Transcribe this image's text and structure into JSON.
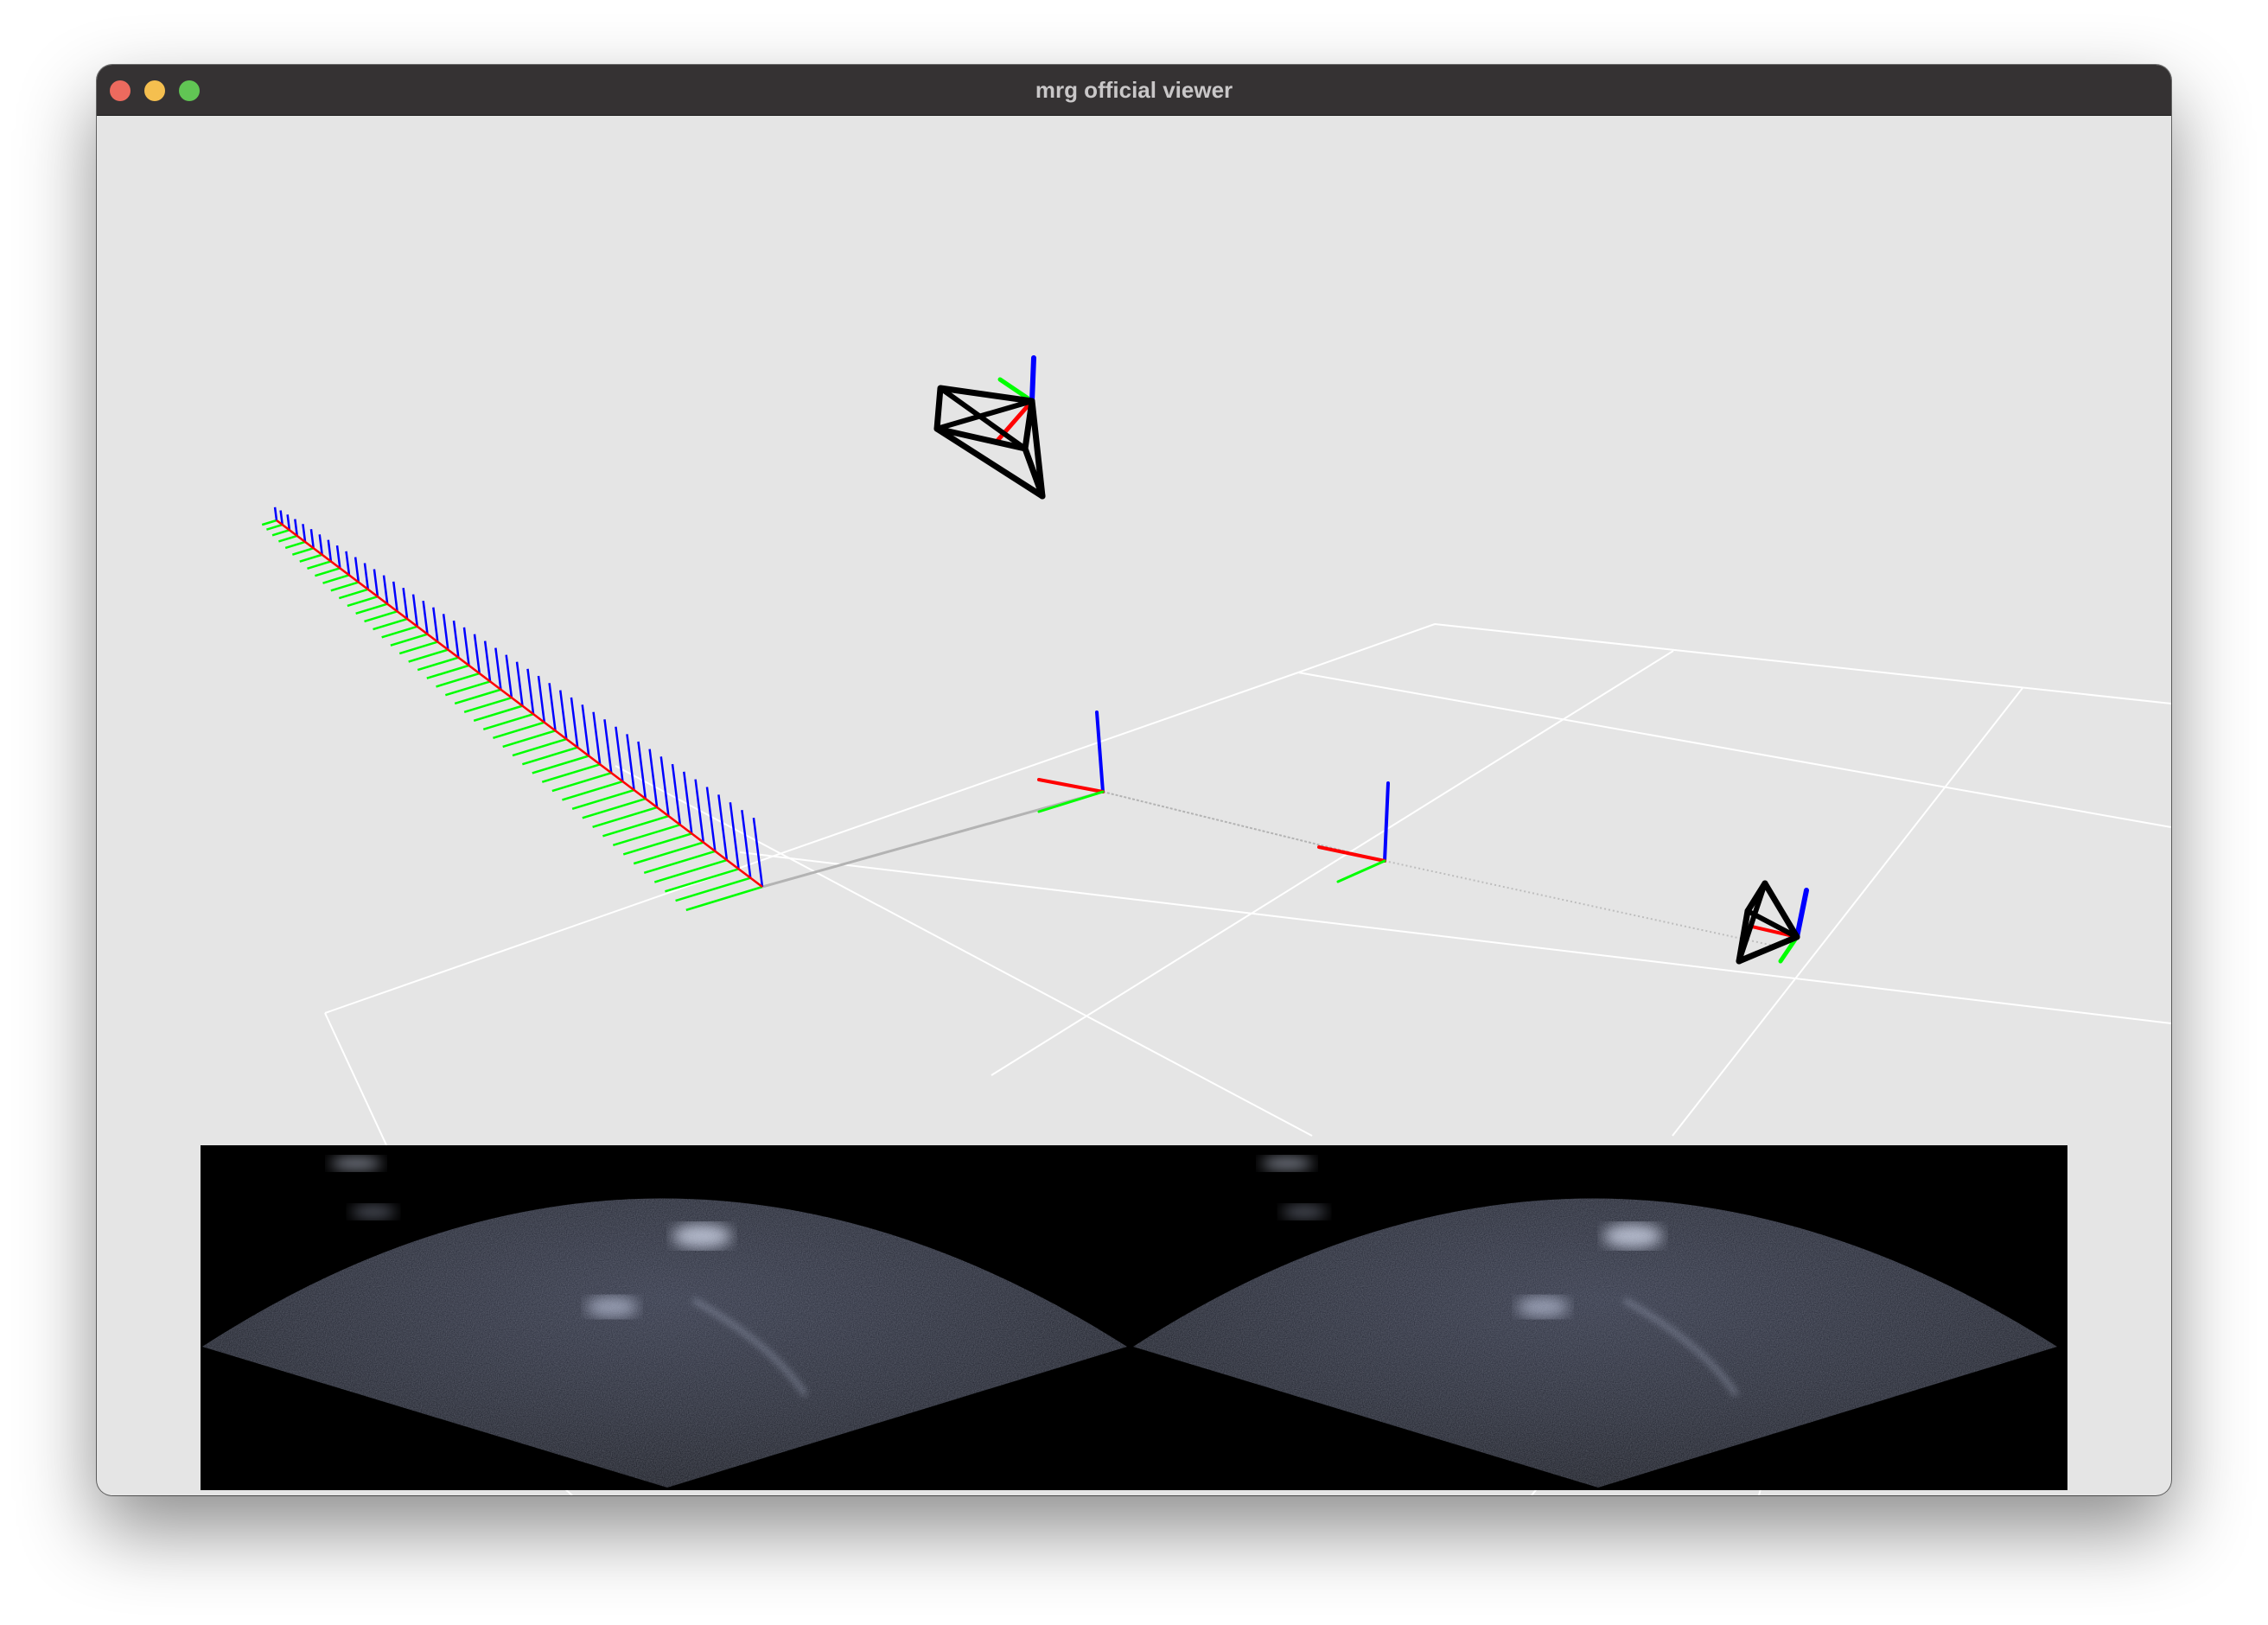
{
  "window": {
    "title": "mrg official viewer"
  },
  "traffic_lights": {
    "close": "close",
    "minimize": "minimize",
    "zoom": "zoom"
  },
  "viewport": {
    "background_color": "#e5e5e5",
    "grid_color": "#ffffff",
    "axis_colors": {
      "x": "#ff0000",
      "y": "#00ff00",
      "z": "#0000ff"
    },
    "camera_frustum_color": "#000000"
  },
  "sonar_panel": {
    "icon": "sonar-fan-image",
    "count": 2
  }
}
